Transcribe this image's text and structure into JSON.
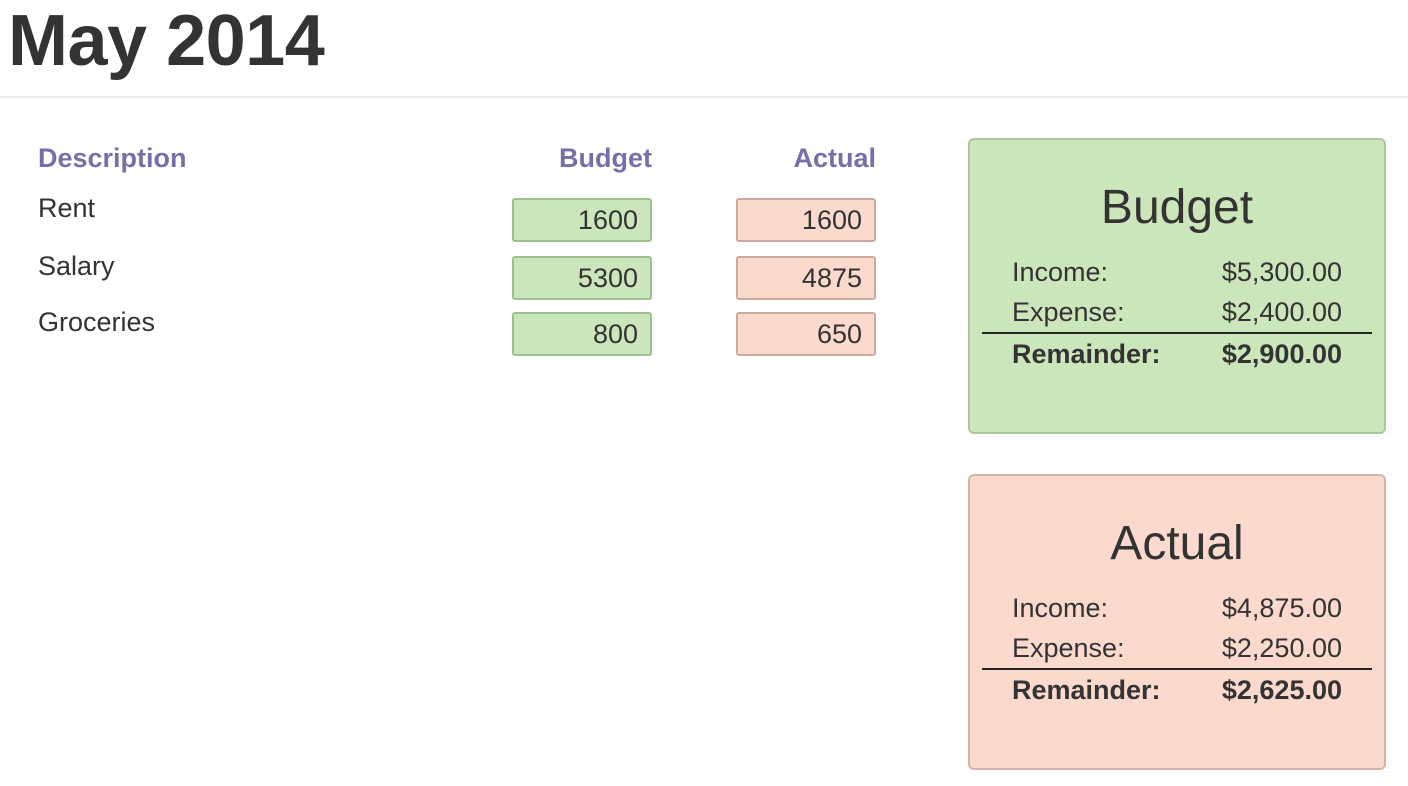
{
  "page": {
    "title": "May 2014"
  },
  "table": {
    "headers": {
      "description": "Description",
      "budget": "Budget",
      "actual": "Actual"
    },
    "rows": [
      {
        "description": "Rent",
        "budget": "1600",
        "actual": "1600"
      },
      {
        "description": "Salary",
        "budget": "5300",
        "actual": "4875"
      },
      {
        "description": "Groceries",
        "budget": "800",
        "actual": "650"
      }
    ]
  },
  "summary": {
    "budget": {
      "title": "Budget",
      "income_label": "Income:",
      "income_value": "$5,300.00",
      "expense_label": "Expense:",
      "expense_value": "$2,400.00",
      "remainder_label": "Remainder:",
      "remainder_value": "$2,900.00"
    },
    "actual": {
      "title": "Actual",
      "income_label": "Income:",
      "income_value": "$4,875.00",
      "expense_label": "Expense:",
      "expense_value": "$2,250.00",
      "remainder_label": "Remainder:",
      "remainder_value": "$2,625.00"
    }
  },
  "colors": {
    "header_text": "#7a6ea8",
    "budget_fill": "#cce6bc",
    "actual_fill": "#fbdacd",
    "text": "#333333"
  }
}
